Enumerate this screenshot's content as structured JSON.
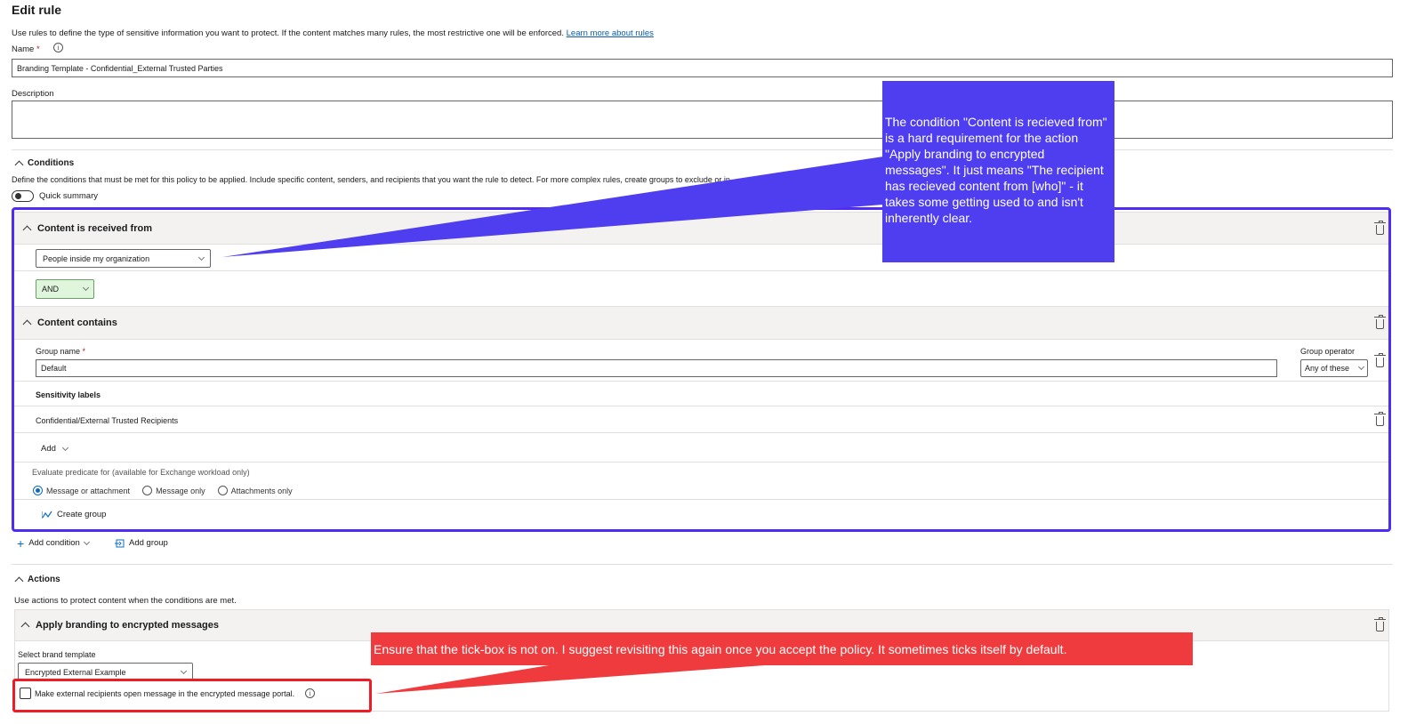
{
  "header": {
    "title": "Edit rule",
    "intro": "Use rules to define the type of sensitive information you want to protect. If the content matches many rules, the most restrictive one will be enforced.",
    "learn_more": "Learn more about rules"
  },
  "form": {
    "name_label": "Name",
    "required_mark": "*",
    "name_value": "Branding Template - Confidential_External Trusted Parties",
    "description_label": "Description",
    "description_value": ""
  },
  "conditions": {
    "heading": "Conditions",
    "description": "Define the conditions that must be met for this policy to be applied. Include specific content, senders, and recipients that you want the rule to detect. For more complex rules, create groups to exclude or in",
    "quick_summary": "Quick summary",
    "received_from": {
      "title": "Content is received from",
      "selected": "People inside my organization"
    },
    "operator": "AND",
    "content_contains": {
      "title": "Content contains",
      "group_name_label": "Group name",
      "group_name_value": "Default",
      "group_operator_label": "Group operator",
      "group_operator_value": "Any of these",
      "sensitivity_labels_heading": "Sensitivity labels",
      "label_item": "Confidential/External Trusted Recipients",
      "add_label": "Add",
      "evaluate_label": "Evaluate predicate for (available for Exchange workload only)",
      "radio_options": [
        "Message or attachment",
        "Message only",
        "Attachments only"
      ],
      "radio_selected_index": 0,
      "create_group": "Create group"
    },
    "add_condition": "Add condition",
    "add_group": "Add group"
  },
  "actions": {
    "heading": "Actions",
    "description": "Use actions to protect content when the conditions are met.",
    "branding": {
      "title": "Apply branding to encrypted messages",
      "select_label": "Select brand template",
      "selected": "Encrypted External Example",
      "portal_checkbox_label": "Make external recipients open message in the encrypted message portal.",
      "portal_checked": false
    }
  },
  "annotations": {
    "blue_callout": "The condition \"Content is recieved from\" is a hard requirement for the action \"Apply branding to encrypted messages\". It just means \"The recipient has recieved content from [who]\" - it takes some getting used to and isn't inherently clear.",
    "red_callout": "Ensure that the tick-box is not on. I suggest revisiting this again once you accept the policy. It sometimes ticks itself by default.",
    "blue_color": "#4f3df0",
    "red_color": "#f03b3e",
    "highlight_blue": "#4f2cf5",
    "highlight_red": "#ee1c25"
  }
}
